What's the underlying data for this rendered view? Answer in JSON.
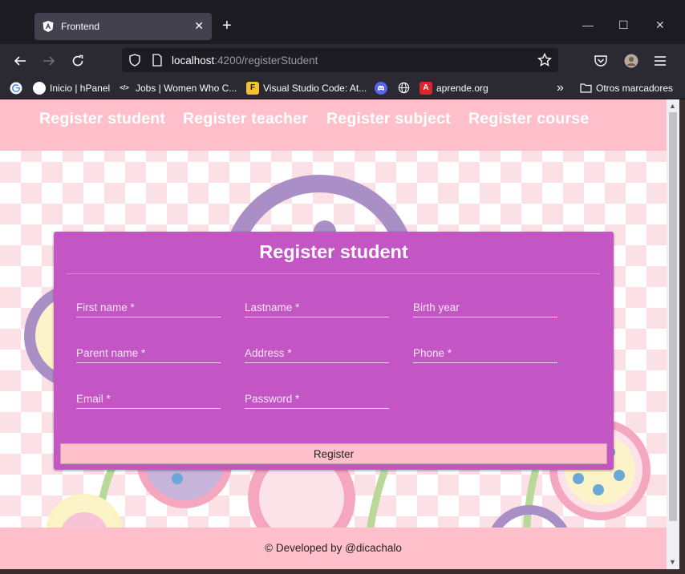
{
  "browser": {
    "tab_title": "Frontend",
    "tab_close": "✕",
    "new_tab": "+",
    "url_host": "localhost",
    "url_path": ":4200/registerStudent",
    "window_buttons": {
      "minimize": "—",
      "maximize": "☐",
      "close": "✕"
    },
    "bookmarks": [
      {
        "label": "Inicio | hPanel",
        "icon": "google-icon"
      },
      {
        "label": "Jobs | Women Who C...",
        "icon": "wwcode-icon"
      },
      {
        "label": "Visual Studio Code: At...",
        "icon": "f-icon"
      },
      {
        "label": "",
        "icon": "discord-icon"
      },
      {
        "label": "",
        "icon": "globe-icon"
      },
      {
        "label": "aprende.org",
        "icon": "aprende-icon"
      }
    ],
    "overflow": "»",
    "other_bookmarks": "Otros marcadores"
  },
  "app": {
    "nav": [
      "Register student",
      "Register teacher",
      "Register subject",
      "Register course"
    ],
    "form": {
      "title": "Register student",
      "fields": [
        {
          "label": "First name *"
        },
        {
          "label": "Lastname *"
        },
        {
          "label": "Birth year"
        },
        {
          "label": "Parent name *"
        },
        {
          "label": "Address *"
        },
        {
          "label": "Phone *"
        },
        {
          "label": "Email *"
        },
        {
          "label": "Password *"
        }
      ],
      "submit_label": "Register"
    },
    "footer": "© Developed by @dicachalo"
  },
  "colors": {
    "header_bg": "#ffc0cb",
    "card_bg": "#c455c4",
    "button_bg": "#ffc0cb"
  }
}
